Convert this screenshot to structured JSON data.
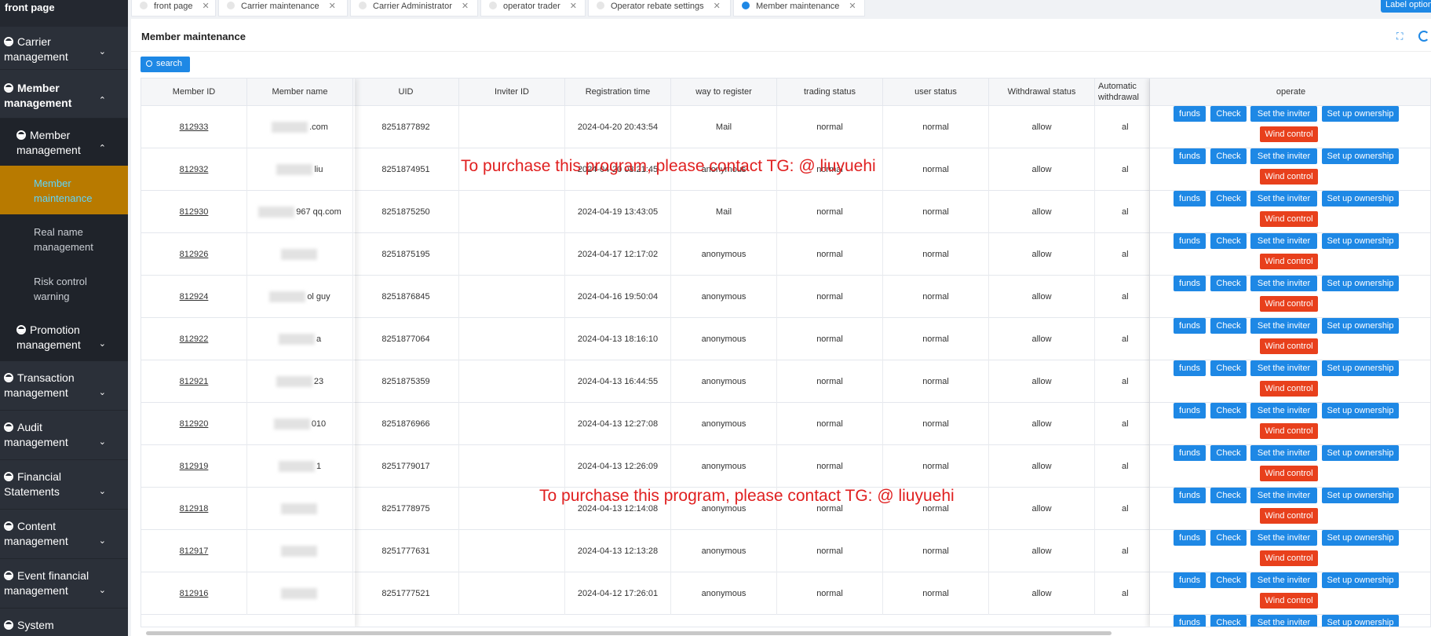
{
  "sidebar": {
    "top": "front page",
    "items": [
      {
        "label": "Carrier management",
        "expanded": false
      },
      {
        "label": "Member management",
        "expanded": true
      },
      {
        "label": "Member management",
        "expanded": true
      },
      {
        "label": "Member maintenance"
      },
      {
        "label": "Real name management"
      },
      {
        "label": "Risk control warning"
      },
      {
        "label": "Promotion management",
        "expanded": false
      },
      {
        "label": "Transaction management",
        "expanded": false
      },
      {
        "label": "Audit management",
        "expanded": false
      },
      {
        "label": "Financial Statements",
        "expanded": false
      },
      {
        "label": "Content management",
        "expanded": false
      },
      {
        "label": "Event financial management",
        "expanded": false
      },
      {
        "label": "System Management",
        "expanded": false
      }
    ]
  },
  "tabs": [
    {
      "label": "front page",
      "active": false
    },
    {
      "label": "Carrier maintenance",
      "active": false
    },
    {
      "label": "Carrier Administrator",
      "active": false
    },
    {
      "label": "operator trader",
      "active": false
    },
    {
      "label": "Operator rebate settings",
      "active": false
    },
    {
      "label": "Member maintenance",
      "active": true
    }
  ],
  "label_options": "Label options",
  "card": {
    "title": "Member maintenance"
  },
  "search_label": "search",
  "columns": [
    "Member ID",
    "Member name",
    "UID",
    "Inviter ID",
    "Registration time",
    "way to register",
    "trading status",
    "user status",
    "Withdrawal status",
    "Automatic withdrawal",
    "operate"
  ],
  "rows": [
    {
      "id": "812933",
      "name": ".com",
      "uid": "8251877892",
      "inviter": "",
      "time": "2024-04-20 20:43:54",
      "way": "Mail",
      "trading": "normal",
      "user": "normal",
      "withdrawal": "allow",
      "auto": "al"
    },
    {
      "id": "812932",
      "name": "liu",
      "uid": "8251874951",
      "inviter": "",
      "time": "2024-04-20 03:21:45",
      "way": "anonymous",
      "trading": "normal",
      "user": "normal",
      "withdrawal": "allow",
      "auto": "al"
    },
    {
      "id": "812930",
      "name": "967 qq.com",
      "uid": "8251875250",
      "inviter": "",
      "time": "2024-04-19 13:43:05",
      "way": "Mail",
      "trading": "normal",
      "user": "normal",
      "withdrawal": "allow",
      "auto": "al"
    },
    {
      "id": "812926",
      "name": "",
      "uid": "8251875195",
      "inviter": "",
      "time": "2024-04-17 12:17:02",
      "way": "anonymous",
      "trading": "normal",
      "user": "normal",
      "withdrawal": "allow",
      "auto": "al"
    },
    {
      "id": "812924",
      "name": "ol guy",
      "uid": "8251876845",
      "inviter": "",
      "time": "2024-04-16 19:50:04",
      "way": "anonymous",
      "trading": "normal",
      "user": "normal",
      "withdrawal": "allow",
      "auto": "al"
    },
    {
      "id": "812922",
      "name": "a",
      "uid": "8251877064",
      "inviter": "",
      "time": "2024-04-13 18:16:10",
      "way": "anonymous",
      "trading": "normal",
      "user": "normal",
      "withdrawal": "allow",
      "auto": "al"
    },
    {
      "id": "812921",
      "name": "23",
      "uid": "8251875359",
      "inviter": "",
      "time": "2024-04-13 16:44:55",
      "way": "anonymous",
      "trading": "normal",
      "user": "normal",
      "withdrawal": "allow",
      "auto": "al"
    },
    {
      "id": "812920",
      "name": "010",
      "uid": "8251876966",
      "inviter": "",
      "time": "2024-04-13 12:27:08",
      "way": "anonymous",
      "trading": "normal",
      "user": "normal",
      "withdrawal": "allow",
      "auto": "al"
    },
    {
      "id": "812919",
      "name": "1",
      "uid": "8251779017",
      "inviter": "",
      "time": "2024-04-13 12:26:09",
      "way": "anonymous",
      "trading": "normal",
      "user": "normal",
      "withdrawal": "allow",
      "auto": "al"
    },
    {
      "id": "812918",
      "name": "",
      "uid": "8251778975",
      "inviter": "",
      "time": "2024-04-13 12:14:08",
      "way": "anonymous",
      "trading": "normal",
      "user": "normal",
      "withdrawal": "allow",
      "auto": "al"
    },
    {
      "id": "812917",
      "name": "",
      "uid": "8251777631",
      "inviter": "",
      "time": "2024-04-13 12:13:28",
      "way": "anonymous",
      "trading": "normal",
      "user": "normal",
      "withdrawal": "allow",
      "auto": "al"
    },
    {
      "id": "812916",
      "name": "",
      "uid": "8251777521",
      "inviter": "",
      "time": "2024-04-12 17:26:01",
      "way": "anonymous",
      "trading": "normal",
      "user": "normal",
      "withdrawal": "allow",
      "auto": "al"
    }
  ],
  "operate_buttons": {
    "funds": "funds",
    "check": "Check",
    "inviter": "Set the inviter",
    "ownership": "Set up ownership",
    "wind": "Wind control"
  },
  "watermark": "To purchase this program, please contact TG: @ liuyuehi",
  "colors": {
    "accent": "#1e88e5",
    "danger": "#e8401c",
    "sidebar": "#2b3039",
    "active_menu": "#b87a00"
  }
}
